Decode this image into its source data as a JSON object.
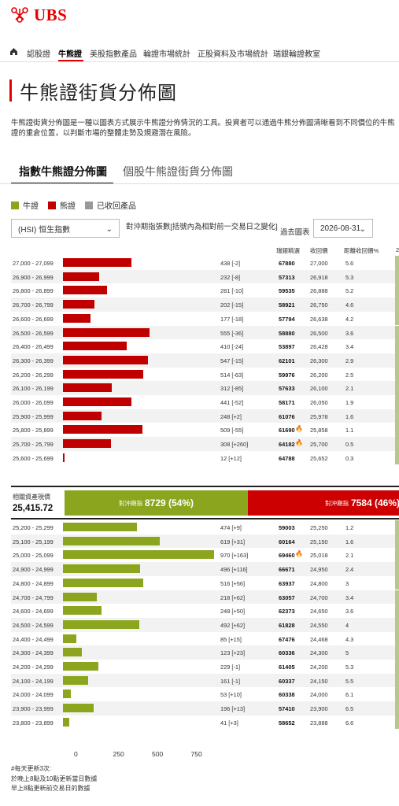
{
  "brand": "UBS",
  "nav": {
    "items": [
      "認股證",
      "牛熊證",
      "美股指數產品",
      "輪證市場統計",
      "正股資料及市場統計",
      "瑞銀輪證教室"
    ],
    "active": "牛熊證"
  },
  "page_title": "牛熊證街貨分佈圖",
  "description": "牛熊證街貨分佈圖是一種以圖表方式展示牛熊證分佈情況的工具。投資者可以通過牛熊分佈圖清晰看到不同價位的牛熊證的重倉位置，以判斷市場的整體走勢及規避潛在風險。",
  "tabs": [
    "指數牛熊證分佈圖",
    "個股牛熊證街貨分佈圖"
  ],
  "legend": [
    {
      "label": "牛證",
      "color": "#8ba61e"
    },
    {
      "label": "熊證",
      "color": "#c00000"
    },
    {
      "label": "已收回產品",
      "color": "#999999"
    }
  ],
  "controls": {
    "underlying": "(HSI) 恒生指數",
    "hedge_note": "對沖期指張數[括號內為相對前一交易日之變化]",
    "past_label": "過去圖表",
    "date": "2026-08-31"
  },
  "table_header": {
    "code": "瑞銀精選",
    "recall": "收回價",
    "distance": "距離收回價%",
    "extra": "2"
  },
  "colors": {
    "bull": "#8ba61e",
    "bear": "#c00000"
  },
  "bear_rows": [
    {
      "range": "27,000 - 27,099",
      "value": 438,
      "count": "438 [-2]",
      "code": "67880",
      "recall": "27,000",
      "dist": "5.6",
      "fire": false
    },
    {
      "range": "26,900 - 26,999",
      "value": 232,
      "count": "232 [-8]",
      "code": "57313",
      "recall": "26,918",
      "dist": "5.3",
      "fire": false
    },
    {
      "range": "26,800 - 26,899",
      "value": 281,
      "count": "281 [-10]",
      "code": "59535",
      "recall": "26,888",
      "dist": "5.2",
      "fire": false
    },
    {
      "range": "26,700 - 26,799",
      "value": 202,
      "count": "202 [-15]",
      "code": "58921",
      "recall": "26,750",
      "dist": "4.6",
      "fire": false
    },
    {
      "range": "26,600 - 26,699",
      "value": 177,
      "count": "177 [-18]",
      "code": "57794",
      "recall": "26,638",
      "dist": "4.2",
      "fire": false
    },
    {
      "range": "26,500 - 26,599",
      "value": 555,
      "count": "555 [-36]",
      "code": "58880",
      "recall": "26,500",
      "dist": "3.6",
      "fire": false
    },
    {
      "range": "26,400 - 26,499",
      "value": 410,
      "count": "410 [-24]",
      "code": "53897",
      "recall": "26,428",
      "dist": "3.4",
      "fire": false
    },
    {
      "range": "26,300 - 26,399",
      "value": 547,
      "count": "547 [-15]",
      "code": "62101",
      "recall": "26,300",
      "dist": "2.9",
      "fire": false
    },
    {
      "range": "26,200 - 26,299",
      "value": 514,
      "count": "514 [-63]",
      "code": "59976",
      "recall": "26,200",
      "dist": "2.5",
      "fire": false
    },
    {
      "range": "26,100 - 26,199",
      "value": 312,
      "count": "312 [-85]",
      "code": "57633",
      "recall": "26,100",
      "dist": "2.1",
      "fire": false
    },
    {
      "range": "26,000 - 26,099",
      "value": 441,
      "count": "441 [-52]",
      "code": "58171",
      "recall": "26,050",
      "dist": "1.9",
      "fire": false
    },
    {
      "range": "25,900 - 25,999",
      "value": 248,
      "count": "248 [+2]",
      "code": "61076",
      "recall": "25,978",
      "dist": "1.6",
      "fire": false
    },
    {
      "range": "25,800 - 25,899",
      "value": 509,
      "count": "509 [-55]",
      "code": "61690",
      "recall": "25,858",
      "dist": "1.1",
      "fire": true
    },
    {
      "range": "25,700 - 25,799",
      "value": 308,
      "count": "308 [+260]",
      "code": "64182",
      "recall": "25,700",
      "dist": "0.5",
      "fire": true
    },
    {
      "range": "25,600 - 25,699",
      "value": 12,
      "count": "12 [+12]",
      "code": "64788",
      "recall": "25,652",
      "dist": "0.3",
      "fire": false
    }
  ],
  "spot": {
    "label": "相關資產現價",
    "value": "25,415.72"
  },
  "ratio": {
    "bull_label": "對沖期指",
    "bull_value": "8729 (54%)",
    "bull_pct": 54,
    "bear_label": "對沖期指",
    "bear_value": "7584 (46%)"
  },
  "bull_rows": [
    {
      "range": "25,200 - 25,299",
      "value": 474,
      "count": "474 [+9]",
      "code": "59003",
      "recall": "25,250",
      "dist": "1.2",
      "fire": false
    },
    {
      "range": "25,100 - 25,199",
      "value": 619,
      "count": "619 [+31]",
      "code": "60164",
      "recall": "25,150",
      "dist": "1.6",
      "fire": false
    },
    {
      "range": "25,000 - 25,099",
      "value": 970,
      "count": "970 [+163]",
      "code": "69460",
      "recall": "25,018",
      "dist": "2.1",
      "fire": true
    },
    {
      "range": "24,900 - 24,999",
      "value": 496,
      "count": "496 [+116]",
      "code": "66671",
      "recall": "24,950",
      "dist": "2.4",
      "fire": false
    },
    {
      "range": "24,800 - 24,899",
      "value": 516,
      "count": "516 [+56]",
      "code": "63937",
      "recall": "24,800",
      "dist": "3",
      "fire": false
    },
    {
      "range": "24,700 - 24,799",
      "value": 218,
      "count": "218 [+62]",
      "code": "63057",
      "recall": "24,700",
      "dist": "3.4",
      "fire": false
    },
    {
      "range": "24,600 - 24,699",
      "value": 248,
      "count": "248 [+50]",
      "code": "62373",
      "recall": "24,650",
      "dist": "3.6",
      "fire": false
    },
    {
      "range": "24,500 - 24,599",
      "value": 492,
      "count": "492 [+62]",
      "code": "61828",
      "recall": "24,550",
      "dist": "4",
      "fire": false
    },
    {
      "range": "24,400 - 24,499",
      "value": 85,
      "count": "85 [+15]",
      "code": "67476",
      "recall": "24,468",
      "dist": "4.3",
      "fire": false
    },
    {
      "range": "24,300 - 24,399",
      "value": 123,
      "count": "123 [+23]",
      "code": "60336",
      "recall": "24,300",
      "dist": "5",
      "fire": false
    },
    {
      "range": "24,200 - 24,299",
      "value": 229,
      "count": "229 [-1]",
      "code": "61405",
      "recall": "24,200",
      "dist": "5.3",
      "fire": false
    },
    {
      "range": "24,100 - 24,199",
      "value": 161,
      "count": "161 [-1]",
      "code": "60337",
      "recall": "24,150",
      "dist": "5.5",
      "fire": false
    },
    {
      "range": "24,000 - 24,099",
      "value": 53,
      "count": "53 [+10]",
      "code": "60338",
      "recall": "24,000",
      "dist": "6.1",
      "fire": false
    },
    {
      "range": "23,900 - 23,999",
      "value": 196,
      "count": "196 [+13]",
      "code": "57410",
      "recall": "23,900",
      "dist": "6.5",
      "fire": false
    },
    {
      "range": "23,800 - 23,899",
      "value": 41,
      "count": "41 [+3]",
      "code": "58652",
      "recall": "23,888",
      "dist": "6.6",
      "fire": false
    }
  ],
  "axis_ticks": [
    "0",
    "250",
    "500",
    "750"
  ],
  "axis_max": 1000,
  "notes": [
    "#每天更新3次:",
    "於晚上8點及10點更新當日數據",
    "早上8點更新前交易日的數據"
  ]
}
